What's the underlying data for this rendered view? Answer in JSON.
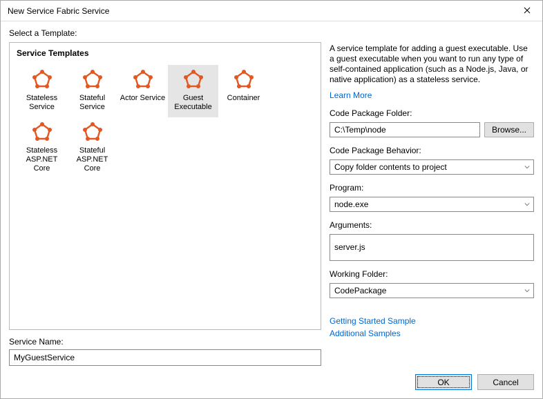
{
  "window": {
    "title": "New Service Fabric Service"
  },
  "prompt": "Select a Template:",
  "templates": {
    "heading": "Service Templates",
    "items": [
      {
        "label": "Stateless Service",
        "selected": false
      },
      {
        "label": "Stateful Service",
        "selected": false
      },
      {
        "label": "Actor Service",
        "selected": false
      },
      {
        "label": "Guest Executable",
        "selected": true
      },
      {
        "label": "Container",
        "selected": false
      },
      {
        "label": "Stateless ASP.NET Core",
        "selected": false
      },
      {
        "label": "Stateful ASP.NET Core",
        "selected": false
      }
    ]
  },
  "serviceName": {
    "label": "Service Name:",
    "value": "MyGuestService"
  },
  "right": {
    "description": "A service template for adding a guest executable. Use a guest executable when you want to run any type of self-contained application (such as a Node.js, Java, or native application) as a stateless service.",
    "learnMore": "Learn More",
    "codePackageFolder": {
      "label": "Code Package Folder:",
      "value": "C:\\Temp\\node",
      "browse": "Browse..."
    },
    "codePackageBehavior": {
      "label": "Code Package Behavior:",
      "value": "Copy folder contents to project"
    },
    "program": {
      "label": "Program:",
      "value": "node.exe"
    },
    "arguments": {
      "label": "Arguments:",
      "value": "server.js"
    },
    "workingFolder": {
      "label": "Working Folder:",
      "value": "CodePackage"
    },
    "links": {
      "gettingStarted": "Getting Started Sample",
      "additional": "Additional Samples"
    }
  },
  "footer": {
    "ok": "OK",
    "cancel": "Cancel"
  }
}
